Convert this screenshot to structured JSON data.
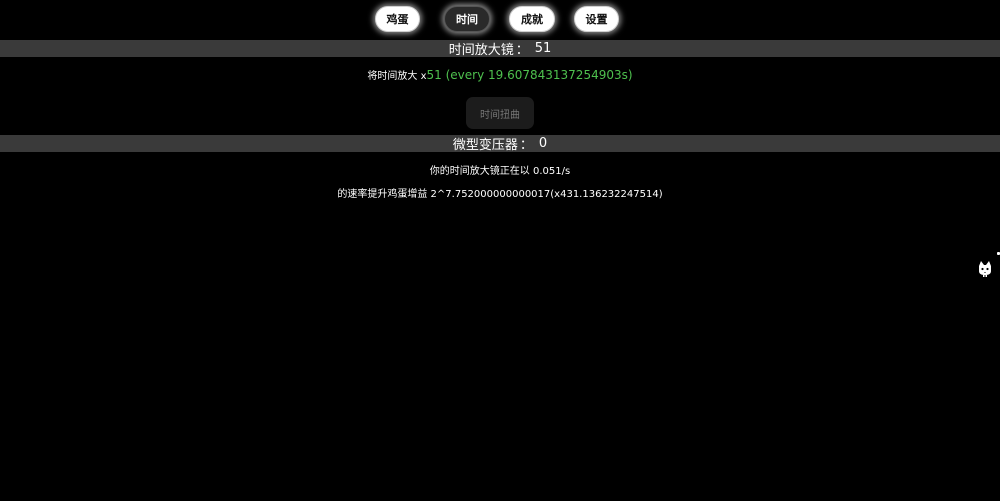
{
  "nav": {
    "egg": "鸡蛋",
    "time": "时间",
    "achievements": "成就",
    "settings": "设置"
  },
  "magnifier": {
    "label": "时间放大镜",
    "colon": "：",
    "count": "51",
    "desc_prefix": "将时间放大 x",
    "desc_value": "51 (every 19.607843137254903s)",
    "button": "时间扭曲"
  },
  "transformer": {
    "label": "微型变压器",
    "colon": "：",
    "count": "0",
    "line1": "你的时间放大镜正在以 0.051/s",
    "line2": "的速率提升鸡蛋增益 2^7.752000000000017(x431.136232247514)"
  },
  "colors": {
    "background": "#000000",
    "bar": "#3a3a3a",
    "accent_green": "#4ec04e"
  },
  "icons": {
    "side": "cat-icon"
  }
}
